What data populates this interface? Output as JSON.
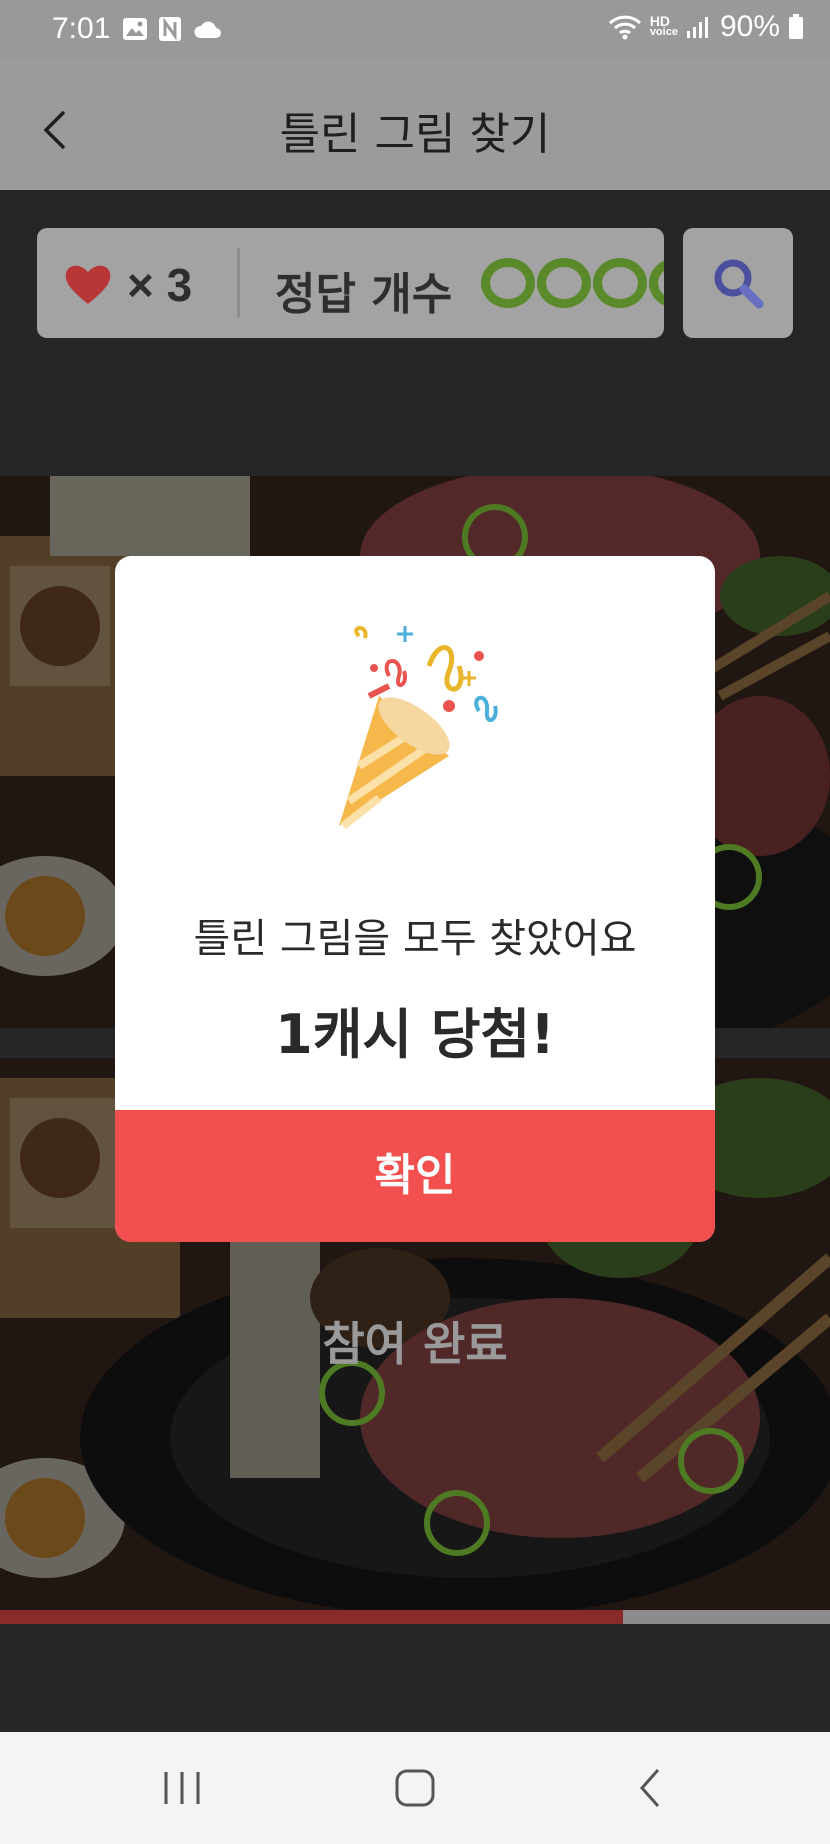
{
  "status_bar": {
    "time": "7:01",
    "battery": "90%",
    "hd_label": "HD",
    "voice_label": "voice"
  },
  "header": {
    "title": "틀린 그림 찾기"
  },
  "info_panel": {
    "lives_label": "× 3",
    "lives_count": 3,
    "answers_label": "정답 개수",
    "found_count": 5,
    "ring_color": "#5a8a2a",
    "heart_color": "#b93636"
  },
  "dialog": {
    "message": "틀린 그림을 모두 찾았어요",
    "prize": "1캐시 당첨!",
    "confirm_label": "확인",
    "button_color": "#f24f4f"
  },
  "game": {
    "participate_label": "참여 완료",
    "progress": 0.75
  },
  "nav": {
    "recents": "recents-icon",
    "home": "home-icon",
    "back": "back-icon"
  }
}
